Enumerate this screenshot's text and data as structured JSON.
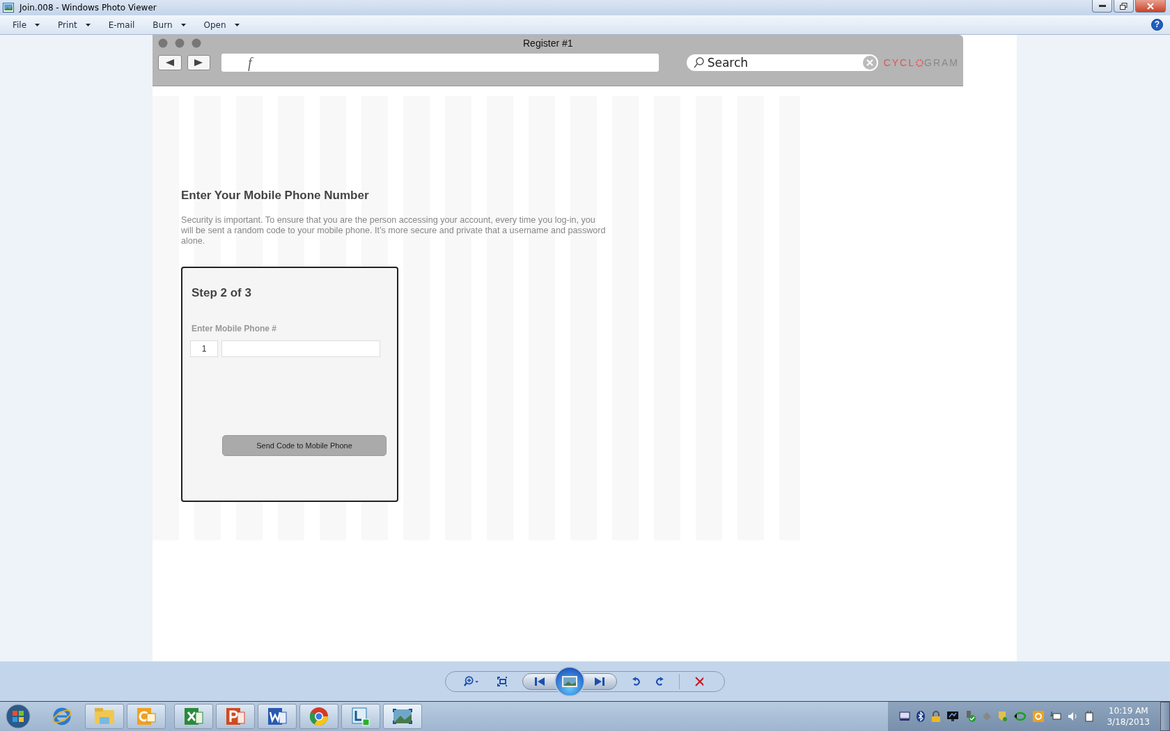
{
  "window": {
    "title": "Join.008 - Windows Photo Viewer"
  },
  "menu": [
    {
      "label": "File",
      "dropdown": true
    },
    {
      "label": "Print",
      "dropdown": true
    },
    {
      "label": "E-mail",
      "dropdown": false
    },
    {
      "label": "Burn",
      "dropdown": true
    },
    {
      "label": "Open",
      "dropdown": true
    }
  ],
  "browser": {
    "title": "Register #1",
    "address": "f",
    "search_placeholder": "Search",
    "logo": [
      "CYCL",
      "GRAM"
    ]
  },
  "page": {
    "heading": "Enter Your Mobile Phone Number",
    "intro": "Security is important.  To ensure that you are the person accessing your account, every time you log-in, you will be sent a random code to your mobile phone.  It’s more secure and private that a username and password alone.",
    "card": {
      "step": "Step 2 of 3",
      "label": "Enter Mobile Phone #",
      "country_code": "1",
      "button": "Send Code to Mobile Phone"
    }
  },
  "help": "?",
  "taskbar": {
    "time": "10:19 AM",
    "date": "3/18/2013"
  }
}
